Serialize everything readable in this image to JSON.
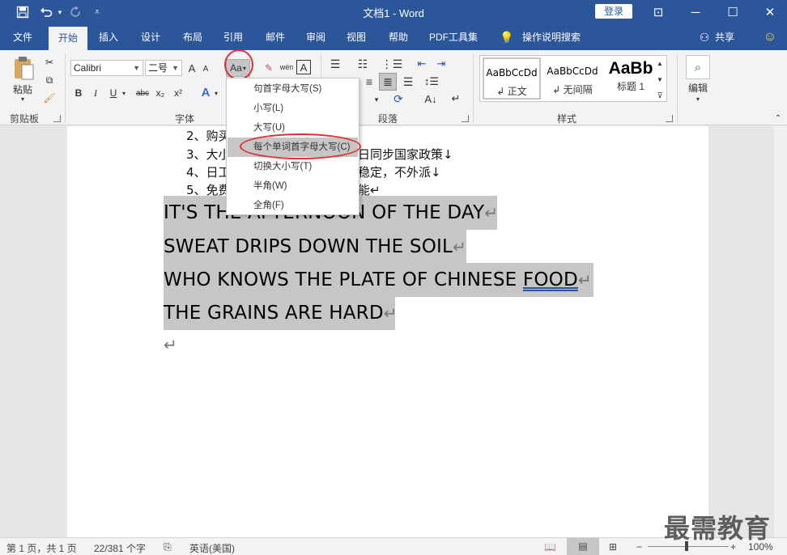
{
  "window": {
    "title": "文档1  -  Word",
    "login_label": "登录",
    "minimize": "─",
    "maximize": "☐",
    "close": "✕",
    "ribbon_display": "⊡"
  },
  "quick_access": {
    "save_icon": "save-icon",
    "undo_icon": "undo-icon",
    "redo_icon": "redo-icon",
    "customize_icon": "customize-icon"
  },
  "tabs": [
    "文件",
    "开始",
    "插入",
    "设计",
    "布局",
    "引用",
    "邮件",
    "审阅",
    "视图",
    "帮助",
    "PDF工具集",
    "操作说明搜索"
  ],
  "active_tab": "开始",
  "share_label": "共享",
  "ribbon": {
    "clipboard": {
      "label": "剪贴板",
      "paste": "粘贴"
    },
    "font": {
      "label": "字体",
      "name": "Calibri",
      "size": "二号",
      "change_case": "Aa",
      "grow": "A",
      "shrink": "A",
      "bold": "B",
      "italic": "I",
      "underline": "U",
      "strike": "abc",
      "sub": "x₂",
      "sup": "x²",
      "phonetic": "wén",
      "border": "A"
    },
    "paragraph": {
      "label": "段落"
    },
    "styles": {
      "label": "样式",
      "items": [
        {
          "sample": "AaBbCcDd",
          "name": "↲ 正文"
        },
        {
          "sample": "AaBbCcDd",
          "name": "↲ 无间隔"
        },
        {
          "sample": "AaBb",
          "name": "标题 1"
        }
      ]
    },
    "editing": {
      "label": "编辑"
    }
  },
  "change_case_menu": {
    "items": [
      "句首字母大写(S)",
      "小写(L)",
      "大写(U)",
      "每个单词首字母大写(C)",
      "切换大小写(T)",
      "半角(W)",
      "全角(F)"
    ],
    "highlighted_index": 3
  },
  "document": {
    "list_lines": [
      "2、购买",
      "3、大小",
      "4、日工",
      "5、免费"
    ],
    "list_tails": [
      "",
      "日同步国家政策↓",
      "稳定，不外派↓",
      "能↵"
    ],
    "selected_lines": [
      "IT'S THE AFTERNOON OF THE DAY",
      "SWEAT DRIPS DOWN THE SOIL",
      "WHO KNOWS THE PLATE OF CHINESE ",
      "THE GRAINS ARE HARD"
    ],
    "food_word": "FOOD",
    "para_mark": "↵"
  },
  "status": {
    "page": "第 1 页，共 1 页",
    "words": "22/381 个字",
    "language": "英语(美国)",
    "zoom": "100%"
  },
  "watermark": "最需教育"
}
